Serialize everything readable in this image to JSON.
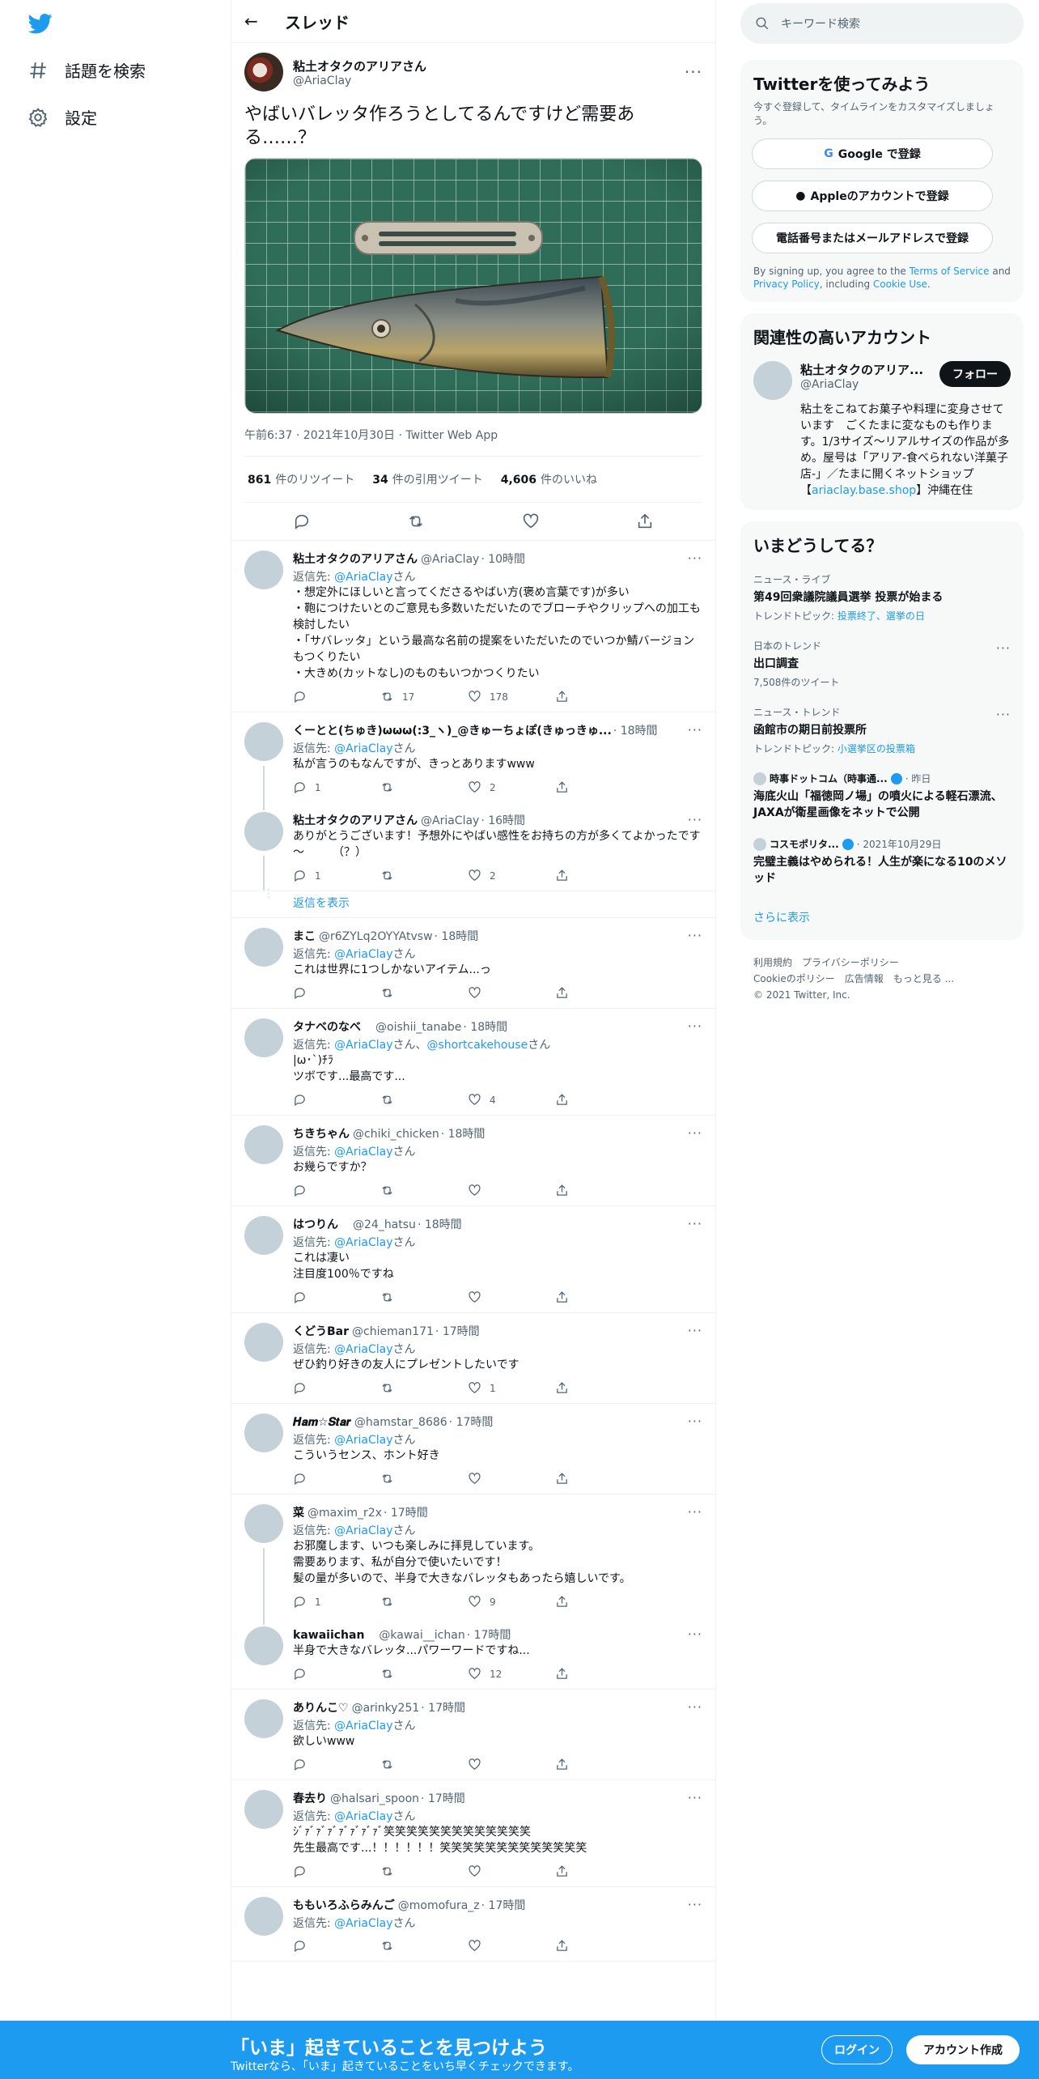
{
  "nav": {
    "explore": "話題を検索",
    "settings": "設定"
  },
  "header": {
    "title": "スレッド"
  },
  "focus": {
    "name": "粘土オタクのアリアさん",
    "handle": "@AriaClay",
    "text": "やばいバレッタ作ろうとしてるんですけど需要ある……？",
    "meta": "午前6:37 · 2021年10月30日 · Twitter Web App",
    "stats": [
      {
        "n": "861",
        "l": "件のリツイート"
      },
      {
        "n": "34",
        "l": "件の引用ツイート"
      },
      {
        "n": "4,606",
        "l": "件のいいね"
      }
    ]
  },
  "tweets": [
    {
      "name": "粘土オタクのアリアさん",
      "handle": "@AriaClay",
      "time": "· 10時間",
      "reply": [
        "返信先: ",
        "@AriaClay",
        "さん"
      ],
      "text": "・想定外にほしいと言ってくださるやばい方(褒め言葉です)が多い\n・鞄につけたいとのご意見も多数いただいたのでブローチやクリップへの加工も検討したい\n・「サバレッタ」という最高な名前の提案をいただいたのでいつか鯖バージョンもつくりたい\n・大きめ(カットなし)のものもいつかつくりたい",
      "c": "",
      "r": "17",
      "l": "178"
    },
    {
      "name": "くーとと(ちゅき)ωωω(:3_ヽ)_@きゅーちょぽ(きゅっきゅ...",
      "handle": "",
      "time": "· 18時間",
      "reply": [
        "返信先: ",
        "@AriaClay",
        "さん"
      ],
      "text": "私が言うのもなんですが、きっとありますwww",
      "c": "1",
      "r": "",
      "l": "2"
    },
    {
      "name": "粘土オタクのアリアさん",
      "handle": "@AriaClay",
      "time": "· 16時間",
      "reply": null,
      "text": "ありがとうございます！予想外にやばい感性をお持ちの方が多くてよかったです～　　　（？）",
      "c": "1",
      "r": "",
      "l": "2"
    },
    {
      "name": "まこ",
      "handle": "@r6ZYLq2OYYAtvsw",
      "time": "· 18時間",
      "reply": [
        "返信先: ",
        "@AriaClay",
        "さん"
      ],
      "text": "これは世界に1つしかないアイテム...っ",
      "c": "",
      "r": "",
      "l": ""
    },
    {
      "name": "タナベのなべ",
      "handle": "　@oishii_tanabe",
      "time": "· 18時間",
      "reply": [
        "返信先: ",
        "@AriaClay",
        "さん、",
        "@shortcakehouse",
        "さん"
      ],
      "text": "|ω･`)ﾁﾗ\nツボです...最高です...",
      "c": "",
      "r": "",
      "l": "4"
    },
    {
      "name": "ちきちゃん",
      "handle": "@chiki_chicken",
      "time": "· 18時間",
      "reply": [
        "返信先: ",
        "@AriaClay",
        "さん"
      ],
      "text": "お幾らですか？",
      "c": "",
      "r": "",
      "l": ""
    },
    {
      "name": "はつりん",
      "handle": "　@24_hatsu",
      "time": "· 18時間",
      "reply": [
        "返信先: ",
        "@AriaClay",
        "さん"
      ],
      "text": "これは凄い\n注目度100％ですね",
      "c": "",
      "r": "",
      "l": ""
    },
    {
      "name": "くどうBar",
      "handle": "@chieman171",
      "time": "· 17時間",
      "reply": [
        "返信先: ",
        "@AriaClay",
        "さん"
      ],
      "text": "ぜひ釣り好きの友人にプレゼントしたいです",
      "c": "",
      "r": "",
      "l": "1"
    },
    {
      "name": "𝑯𝒂𝒎☆𝑺𝒕𝒂𝒓",
      "handle": "@hamstar_8686",
      "time": "· 17時間",
      "reply": [
        "返信先: ",
        "@AriaClay",
        "さん"
      ],
      "text": "こういうセンス、ホント好き",
      "c": "",
      "r": "",
      "l": ""
    },
    {
      "name": "菜",
      "handle": "@maxim_r2x",
      "time": "· 17時間",
      "reply": [
        "返信先: ",
        "@AriaClay",
        "さん"
      ],
      "text": "お邪魔します、いつも楽しみに拝見しています。\n需要あります、私が自分で使いたいです！\n髪の量が多いので、半身で大きなバレッタもあったら嬉しいです。",
      "c": "1",
      "r": "",
      "l": "9"
    },
    {
      "name": "kawaiichan",
      "handle": "　@kawai__ichan",
      "time": "· 17時間",
      "reply": null,
      "text": "半身で大きなバレッタ...パワーワードですね...",
      "c": "",
      "r": "",
      "l": "12"
    },
    {
      "name": "ありんこ♡",
      "handle": "@arinky251",
      "time": "· 17時間",
      "reply": [
        "返信先: ",
        "@AriaClay",
        "さん"
      ],
      "text": "欲しいwww",
      "c": "",
      "r": "",
      "l": ""
    },
    {
      "name": "春去り",
      "handle": "@halsari_spoon",
      "time": "· 17時間",
      "reply": [
        "返信先: ",
        "@AriaClay",
        "さん"
      ],
      "text": "ｼﾞｧﾞｧﾞｧﾞｧﾞｧﾞｧﾞｧﾞ笑笑笑笑笑笑笑笑笑笑笑笑笑\n先生最高です...！！！！！！笑笑笑笑笑笑笑笑笑笑笑笑笑",
      "c": "",
      "r": "",
      "l": ""
    },
    {
      "name": "ももいろふらみんご",
      "handle": "@momofura_z",
      "time": "· 17時間",
      "reply": [
        "返信先: ",
        "@AriaClay",
        "さん"
      ],
      "text": "",
      "c": "",
      "r": "",
      "l": ""
    }
  ],
  "show_replies": "返信を表示",
  "right": {
    "search_placeholder": "キーワード検索",
    "signup": {
      "title": "Twitterを使ってみよう",
      "sub": "今すぐ登録して、タイムラインをカスタマイズしましょう。",
      "google": "Google で登録",
      "apple": "Appleのアカウントで登録",
      "phone": "電話番号またはメールアドレスで登録",
      "legal1": "By signing up, you agree to the ",
      "tos": "Terms of Service",
      "legal2": " and ",
      "privacy": "Privacy Policy",
      "legal3": ", including ",
      "cookie": "Cookie Use",
      "legal4": "."
    },
    "related": {
      "title": "関連性の高いアカウント",
      "name": "粘土オタクのアリア...",
      "handle": "@AriaClay",
      "follow": "フォロー",
      "bio": "粘土をこねてお菓子や料理に変身させています　ごくたまに変なものも作ります。1/3サイズ〜リアルサイズの作品が多め。屋号は「アリア-食べられない洋菓子店-」／たまに開くネットショップ【",
      "bio_link": "ariaclay.base.shop",
      "bio_end": "】沖縄在住"
    },
    "trends": {
      "title": "いまどうしてる？",
      "items": [
        {
          "c": "ニュース・ライブ",
          "t": "第49回衆議院議員選挙 投票が始まる",
          "d": "トレンドトピック: ",
          "dl": "投票終了、選挙の日",
          "more": false
        },
        {
          "c": "日本のトレンド",
          "t": "出口調査",
          "d": "7,508件のツイート",
          "dl": "",
          "more": true
        },
        {
          "c": "ニュース・トレンド",
          "t": "函館市の期日前投票所",
          "d": "トレンドトピック: ",
          "dl": "小選挙区の投票箱",
          "more": true
        }
      ],
      "news": [
        {
          "src": "時事ドットコム（時事通...",
          "time": "· 昨日",
          "t": "海底火山「福徳岡ノ場」の噴火による軽石漂流、JAXAが衛星画像をネットで公開"
        },
        {
          "src": "コスモポリタ...",
          "time": "· 2021年10月29日",
          "t": "完璧主義はやめられる！人生が楽になる10のメソッド"
        }
      ],
      "more": "さらに表示"
    },
    "footer": {
      "l1": [
        "利用規約",
        "プライバシーポリシー"
      ],
      "l2": [
        "Cookieのポリシー",
        "広告情報",
        "もっと見る ..."
      ],
      "copy": "© 2021 Twitter, Inc."
    }
  },
  "bottom": {
    "title": "「いま」起きていることを見つけよう",
    "sub": "Twitterなら、「いま」起きていることをいち早くチェックできます。",
    "login": "ログイン",
    "signup": "アカウント作成"
  },
  "colors": {
    "accent": "#1d9bf0",
    "text": "#0f1419",
    "muted": "#536471"
  }
}
